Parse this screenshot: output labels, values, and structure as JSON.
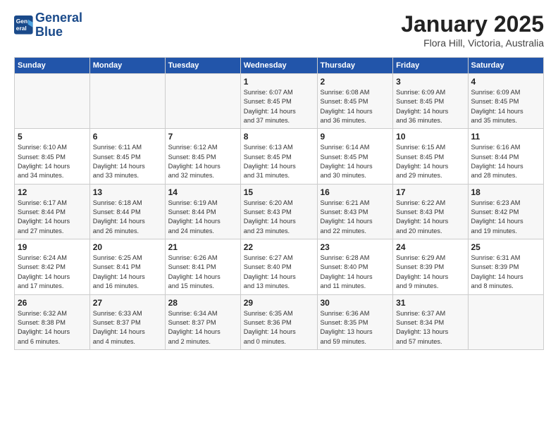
{
  "header": {
    "logo_line1": "General",
    "logo_line2": "Blue",
    "month": "January 2025",
    "location": "Flora Hill, Victoria, Australia"
  },
  "weekdays": [
    "Sunday",
    "Monday",
    "Tuesday",
    "Wednesday",
    "Thursday",
    "Friday",
    "Saturday"
  ],
  "weeks": [
    [
      {
        "day": "",
        "info": ""
      },
      {
        "day": "",
        "info": ""
      },
      {
        "day": "",
        "info": ""
      },
      {
        "day": "1",
        "info": "Sunrise: 6:07 AM\nSunset: 8:45 PM\nDaylight: 14 hours\nand 37 minutes."
      },
      {
        "day": "2",
        "info": "Sunrise: 6:08 AM\nSunset: 8:45 PM\nDaylight: 14 hours\nand 36 minutes."
      },
      {
        "day": "3",
        "info": "Sunrise: 6:09 AM\nSunset: 8:45 PM\nDaylight: 14 hours\nand 36 minutes."
      },
      {
        "day": "4",
        "info": "Sunrise: 6:09 AM\nSunset: 8:45 PM\nDaylight: 14 hours\nand 35 minutes."
      }
    ],
    [
      {
        "day": "5",
        "info": "Sunrise: 6:10 AM\nSunset: 8:45 PM\nDaylight: 14 hours\nand 34 minutes."
      },
      {
        "day": "6",
        "info": "Sunrise: 6:11 AM\nSunset: 8:45 PM\nDaylight: 14 hours\nand 33 minutes."
      },
      {
        "day": "7",
        "info": "Sunrise: 6:12 AM\nSunset: 8:45 PM\nDaylight: 14 hours\nand 32 minutes."
      },
      {
        "day": "8",
        "info": "Sunrise: 6:13 AM\nSunset: 8:45 PM\nDaylight: 14 hours\nand 31 minutes."
      },
      {
        "day": "9",
        "info": "Sunrise: 6:14 AM\nSunset: 8:45 PM\nDaylight: 14 hours\nand 30 minutes."
      },
      {
        "day": "10",
        "info": "Sunrise: 6:15 AM\nSunset: 8:45 PM\nDaylight: 14 hours\nand 29 minutes."
      },
      {
        "day": "11",
        "info": "Sunrise: 6:16 AM\nSunset: 8:44 PM\nDaylight: 14 hours\nand 28 minutes."
      }
    ],
    [
      {
        "day": "12",
        "info": "Sunrise: 6:17 AM\nSunset: 8:44 PM\nDaylight: 14 hours\nand 27 minutes."
      },
      {
        "day": "13",
        "info": "Sunrise: 6:18 AM\nSunset: 8:44 PM\nDaylight: 14 hours\nand 26 minutes."
      },
      {
        "day": "14",
        "info": "Sunrise: 6:19 AM\nSunset: 8:44 PM\nDaylight: 14 hours\nand 24 minutes."
      },
      {
        "day": "15",
        "info": "Sunrise: 6:20 AM\nSunset: 8:43 PM\nDaylight: 14 hours\nand 23 minutes."
      },
      {
        "day": "16",
        "info": "Sunrise: 6:21 AM\nSunset: 8:43 PM\nDaylight: 14 hours\nand 22 minutes."
      },
      {
        "day": "17",
        "info": "Sunrise: 6:22 AM\nSunset: 8:43 PM\nDaylight: 14 hours\nand 20 minutes."
      },
      {
        "day": "18",
        "info": "Sunrise: 6:23 AM\nSunset: 8:42 PM\nDaylight: 14 hours\nand 19 minutes."
      }
    ],
    [
      {
        "day": "19",
        "info": "Sunrise: 6:24 AM\nSunset: 8:42 PM\nDaylight: 14 hours\nand 17 minutes."
      },
      {
        "day": "20",
        "info": "Sunrise: 6:25 AM\nSunset: 8:41 PM\nDaylight: 14 hours\nand 16 minutes."
      },
      {
        "day": "21",
        "info": "Sunrise: 6:26 AM\nSunset: 8:41 PM\nDaylight: 14 hours\nand 15 minutes."
      },
      {
        "day": "22",
        "info": "Sunrise: 6:27 AM\nSunset: 8:40 PM\nDaylight: 14 hours\nand 13 minutes."
      },
      {
        "day": "23",
        "info": "Sunrise: 6:28 AM\nSunset: 8:40 PM\nDaylight: 14 hours\nand 11 minutes."
      },
      {
        "day": "24",
        "info": "Sunrise: 6:29 AM\nSunset: 8:39 PM\nDaylight: 14 hours\nand 9 minutes."
      },
      {
        "day": "25",
        "info": "Sunrise: 6:31 AM\nSunset: 8:39 PM\nDaylight: 14 hours\nand 8 minutes."
      }
    ],
    [
      {
        "day": "26",
        "info": "Sunrise: 6:32 AM\nSunset: 8:38 PM\nDaylight: 14 hours\nand 6 minutes."
      },
      {
        "day": "27",
        "info": "Sunrise: 6:33 AM\nSunset: 8:37 PM\nDaylight: 14 hours\nand 4 minutes."
      },
      {
        "day": "28",
        "info": "Sunrise: 6:34 AM\nSunset: 8:37 PM\nDaylight: 14 hours\nand 2 minutes."
      },
      {
        "day": "29",
        "info": "Sunrise: 6:35 AM\nSunset: 8:36 PM\nDaylight: 14 hours\nand 0 minutes."
      },
      {
        "day": "30",
        "info": "Sunrise: 6:36 AM\nSunset: 8:35 PM\nDaylight: 13 hours\nand 59 minutes."
      },
      {
        "day": "31",
        "info": "Sunrise: 6:37 AM\nSunset: 8:34 PM\nDaylight: 13 hours\nand 57 minutes."
      },
      {
        "day": "",
        "info": ""
      }
    ]
  ]
}
